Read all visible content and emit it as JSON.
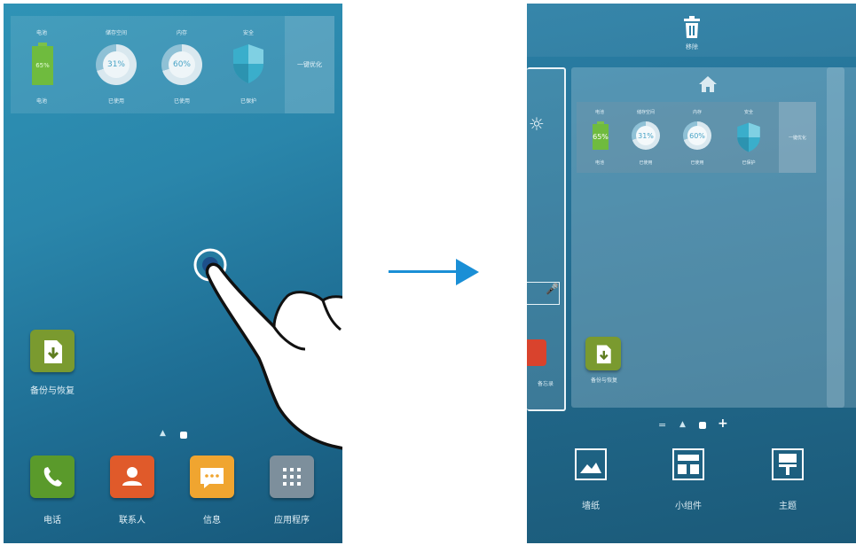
{
  "left_screen": {
    "widget": {
      "items": [
        {
          "caption": "电池",
          "value": "65%",
          "sub": "电池"
        },
        {
          "caption": "储存空间",
          "value": "31%",
          "sub": "已使用"
        },
        {
          "caption": "内存",
          "value": "60%",
          "sub": "已使用"
        },
        {
          "caption": "安全",
          "value": "",
          "sub": "已保护"
        }
      ],
      "clean_label": "一键优化"
    },
    "apps": [
      {
        "label": "备份与恢复",
        "icon": "download-icon",
        "color": "#7a9a2f"
      }
    ],
    "dock": [
      {
        "label": "电话",
        "icon": "phone-icon",
        "color": "#5a9a2b"
      },
      {
        "label": "联系人",
        "icon": "contact-icon",
        "color": "#e05a2a"
      },
      {
        "label": "信息",
        "icon": "message-icon",
        "color": "#f0a530"
      },
      {
        "label": "应用程序",
        "icon": "apps-grid-icon",
        "color": "#7d8f9c"
      }
    ]
  },
  "right_screen": {
    "top_label": "移除",
    "widget": {
      "items": [
        {
          "caption": "电池",
          "value": "65%",
          "sub": "电池"
        },
        {
          "caption": "储存空间",
          "value": "31%",
          "sub": "已使用"
        },
        {
          "caption": "内存",
          "value": "60%",
          "sub": "已使用"
        },
        {
          "caption": "安全",
          "value": "",
          "sub": "已保护"
        }
      ],
      "clean_label": "一键优化"
    },
    "app_label": "备份与恢复",
    "prev_app_label": "备忘录",
    "bottom_options": [
      {
        "label": "墙纸",
        "icon": "wallpaper-icon"
      },
      {
        "label": "小组件",
        "icon": "widgets-icon"
      },
      {
        "label": "主题",
        "icon": "themes-icon"
      }
    ],
    "indicator_plus": "+",
    "indicator_menu": "="
  },
  "colors": {
    "arrow": "#1a8fd6",
    "battery": "#6fbb3e",
    "shield": "#3aaecb"
  }
}
